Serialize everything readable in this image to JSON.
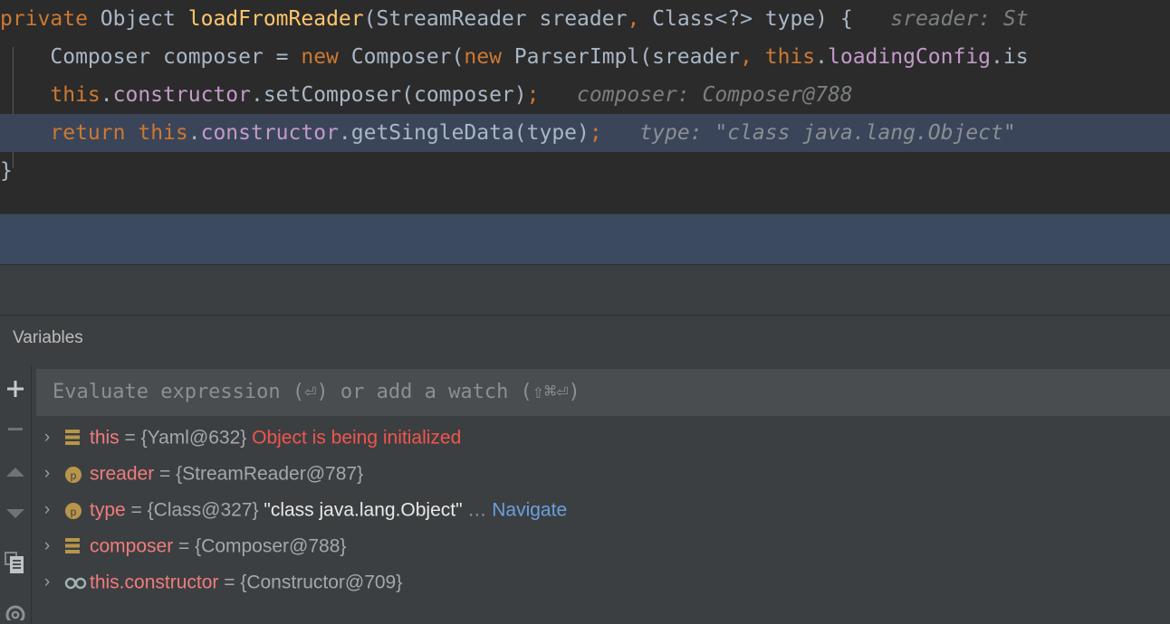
{
  "editor": {
    "lines": [
      {
        "id": "line-1",
        "tokens": [
          {
            "t": "private",
            "c": "kw"
          },
          {
            "t": " ",
            "c": "plain"
          },
          {
            "t": "Object",
            "c": "type"
          },
          {
            "t": " ",
            "c": "plain"
          },
          {
            "t": "loadFromReader",
            "c": "method"
          },
          {
            "t": "(",
            "c": "punct"
          },
          {
            "t": "StreamReader sreader",
            "c": "plain"
          },
          {
            "t": ",",
            "c": "semi"
          },
          {
            "t": " Class<?> type) {",
            "c": "plain"
          }
        ],
        "hint": "sreader: St",
        "highlight": false
      },
      {
        "id": "line-2",
        "tokens": [
          {
            "t": "    Composer composer = ",
            "c": "plain"
          },
          {
            "t": "new",
            "c": "kw"
          },
          {
            "t": " Composer(",
            "c": "plain"
          },
          {
            "t": "new",
            "c": "kw"
          },
          {
            "t": " ParserImpl(sreader",
            "c": "plain"
          },
          {
            "t": ",",
            "c": "semi"
          },
          {
            "t": " ",
            "c": "plain"
          },
          {
            "t": "this",
            "c": "kw"
          },
          {
            "t": ".",
            "c": "plain"
          },
          {
            "t": "loadingConfig",
            "c": "field"
          },
          {
            "t": ".is",
            "c": "plain"
          }
        ],
        "hint": "",
        "highlight": false
      },
      {
        "id": "line-3",
        "tokens": [
          {
            "t": "    ",
            "c": "plain"
          },
          {
            "t": "this",
            "c": "kw"
          },
          {
            "t": ".",
            "c": "plain"
          },
          {
            "t": "constructor",
            "c": "field"
          },
          {
            "t": ".setComposer(composer)",
            "c": "plain"
          },
          {
            "t": ";",
            "c": "semi"
          }
        ],
        "hint": "composer: Composer@788",
        "highlight": false
      },
      {
        "id": "line-4",
        "tokens": [
          {
            "t": "    ",
            "c": "plain"
          },
          {
            "t": "return",
            "c": "kw"
          },
          {
            "t": " ",
            "c": "plain"
          },
          {
            "t": "this",
            "c": "kw"
          },
          {
            "t": ".",
            "c": "plain"
          },
          {
            "t": "constructor",
            "c": "field"
          },
          {
            "t": ".getSingleData(type)",
            "c": "plain"
          },
          {
            "t": ";",
            "c": "semi"
          }
        ],
        "hint": "type: \"class java.lang.Object\"",
        "highlight": true
      },
      {
        "id": "line-5",
        "tokens": [
          {
            "t": "}",
            "c": "plain"
          }
        ],
        "hint": "",
        "highlight": false
      }
    ]
  },
  "tabbar": {
    "variables_tab": "Variables"
  },
  "toolbar": {
    "buttons": [
      {
        "name": "add-watch-button",
        "icon": "plus-icon",
        "enabled": true
      },
      {
        "name": "remove-watch-button",
        "icon": "minus-icon",
        "enabled": false
      },
      {
        "name": "move-up-button",
        "icon": "triangle-up-icon",
        "enabled": true
      },
      {
        "name": "move-down-button",
        "icon": "triangle-down-icon",
        "enabled": true
      },
      {
        "name": "copy-value-button",
        "icon": "copy-icon",
        "enabled": true
      },
      {
        "name": "settings-button",
        "icon": "gear-icon",
        "enabled": true
      }
    ]
  },
  "evaluate": {
    "placeholder": "Evaluate expression (⏎) or add a watch (⇧⌘⏎)",
    "value": ""
  },
  "variables": {
    "rows": [
      {
        "id": "var-this",
        "expander": "›",
        "icon": "field-group-icon",
        "name": "this",
        "equals": " = ",
        "ref": "{Yaml@632}",
        "string_value": "",
        "ellipsis": "",
        "link": "",
        "error": "Object is being initialized"
      },
      {
        "id": "var-sreader",
        "expander": "›",
        "icon": "parameter-icon",
        "name": "sreader",
        "equals": " = ",
        "ref": "{StreamReader@787}",
        "string_value": "",
        "ellipsis": "",
        "link": "",
        "error": ""
      },
      {
        "id": "var-type",
        "expander": "›",
        "icon": "parameter-icon",
        "name": "type",
        "equals": " = ",
        "ref": "{Class@327}",
        "string_value": "\"class java.lang.Object\"",
        "ellipsis": "…",
        "link": "Navigate",
        "error": ""
      },
      {
        "id": "var-composer",
        "expander": "›",
        "icon": "field-group-icon",
        "name": "composer",
        "equals": " = ",
        "ref": "{Composer@788}",
        "string_value": "",
        "ellipsis": "",
        "link": "",
        "error": ""
      },
      {
        "id": "var-this-constructor",
        "expander": "›",
        "icon": "watch-icon",
        "name": "this.constructor",
        "equals": " = ",
        "ref": "{Constructor@709}",
        "string_value": "",
        "ellipsis": "",
        "link": "",
        "error": ""
      }
    ]
  },
  "colors": {
    "editor_bg": "#2b2b2b",
    "exec_line_bg": "#3a4559",
    "panel_bg": "#3c3f41",
    "band_blue": "#3c4a5f",
    "keyword": "#cc7832",
    "method": "#ffc66d",
    "field": "#c39ac9",
    "text": "#a9b7c6",
    "hint": "#7b7f82",
    "var_name": "#f07c7c",
    "error": "#f0554d",
    "link": "#6a9fe0",
    "icon_gold": "#b8954a"
  }
}
